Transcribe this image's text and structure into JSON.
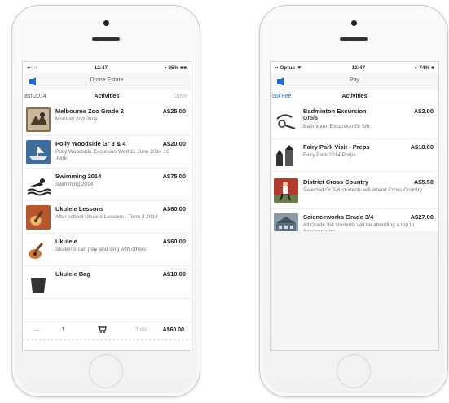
{
  "left_screen": {
    "status_time": "12:47",
    "status_right": "• 85% ■■",
    "status_left": "••○○ ",
    "nav_title": "Drone Estate",
    "tab_left": "ast 2014",
    "tab_center": "Activities",
    "tab_right": "Done",
    "items": [
      {
        "title": "Melbourne Zoo Grade 2",
        "price": "A$25.00",
        "desc": "Monday 2nd June",
        "icon": "zoo-icon"
      },
      {
        "title": "Polly Woodside Gr 3 & 4",
        "price": "A$20.00",
        "desc": "Polly Woodside Excursion Wed 11 June 2014 10 June",
        "icon": "ship-icon"
      },
      {
        "title": "Swimming 2014",
        "price": "A$75.00",
        "desc": "Swimming 2014",
        "icon": "swimmer-icon"
      },
      {
        "title": "Ukulele Lessons",
        "price": "A$60.00",
        "desc": "After school Ukulele Lessons - Term 3 2014",
        "icon": "ukulele-icon"
      },
      {
        "title": "Ukulele",
        "price": "A$60.00",
        "desc": "Students can play and sing with others",
        "icon": "ukulele-icon"
      },
      {
        "title": "Ukulele Bag",
        "price": "A$10.00",
        "desc": "",
        "icon": "bag-icon"
      }
    ],
    "cart": {
      "minus_label": "—",
      "qty": "1",
      "total_label": "Total",
      "total": "A$60.00"
    }
  },
  "right_screen": {
    "status_left": "•• Optus ▼",
    "status_time": "12:47",
    "status_right": "▸ 74% ■",
    "nav_title": "Pay",
    "tab_left": "ool Fee",
    "tab_center": "Activities",
    "items": [
      {
        "title": "Badminton Excursion",
        "sub": "Gr5/6",
        "price": "A$2.00",
        "desc": "Badminton Excursion Gr 5/6",
        "icon": "badminton-icon"
      },
      {
        "title": "Fairy Park Visit - Preps",
        "price": "A$18.00",
        "desc": "Fairy Park 2014 Preps",
        "icon": "fairy-park-icon"
      },
      {
        "title": "District Cross Country",
        "price": "A$5.50",
        "desc": "Selected Gr 3-6 students will attend Cross Country",
        "icon": "runner-icon"
      },
      {
        "title": "Scienceworks Grade 3/4",
        "price": "A$27.00",
        "desc": "All Grade 3/4 students will be attending a trip to Scienceworks",
        "icon": "scienceworks-icon"
      }
    ]
  }
}
